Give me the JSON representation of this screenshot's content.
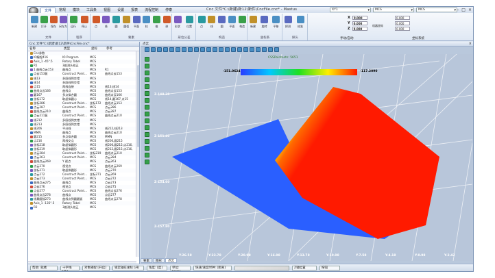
{
  "app": {
    "title": "Cnc 文件*C:\\新建\\新12\\新件\\CncFile.cnc* - Mastus"
  },
  "menu": {
    "tabs": [
      "文件",
      "常规",
      "模块",
      "工具条",
      "视图",
      "设置",
      "报表",
      "流程控制",
      "停泰"
    ],
    "active": 0
  },
  "selectors": {
    "coord1": "XY1",
    "coord2": "MCS",
    "coord3": "MCS"
  },
  "ribbon": {
    "groups": [
      {
        "label": "文件",
        "buttons": [
          "新建",
          "打开",
          "保存",
          "另存为"
        ]
      },
      {
        "label": "程序",
        "buttons": [
          "运行",
          "停止"
        ]
      },
      {
        "label": "要素",
        "buttons": [
          "点",
          "线",
          "圆",
          "圆弧",
          "平面",
          "柱",
          "椎",
          "球"
        ]
      },
      {
        "label": "形位公差",
        "buttons": [
          "形状",
          "位置"
        ]
      },
      {
        "label": "构造",
        "buttons": [
          "点",
          "线",
          "圆",
          "平面",
          "构造"
        ]
      },
      {
        "label": "坐标系",
        "buttons": [
          "新建",
          "旋转",
          "平移"
        ]
      },
      {
        "label": "探头",
        "buttons": [
          "探测",
          "校准"
        ]
      }
    ],
    "xyz": {
      "x": "0.000",
      "y": "0.000",
      "z": "0.000",
      "label": "机器坐标",
      "extra1": "0.000",
      "extra2": "0.000",
      "extra3": "0.000",
      "g1": "手动/自动",
      "g2": "坐标系统"
    }
  },
  "left_panel": {
    "title": "Cnc 文件*C:\\新建\\新12\\新件\\CncFile.cnc*",
    "columns": [
      "名称",
      "类型",
      "坐标",
      "参考"
    ],
    "rows": [
      [
        "Cnc参数",
        "",
        "",
        ""
      ],
      [
        "IO编程416",
        "IO Program",
        "MCS",
        ""
      ],
      [
        "Axis_1 -45°.5",
        "Rotary Tabel",
        "MCS",
        ""
      ],
      [
        "R1",
        "3维测头校正",
        "MCS",
        ""
      ],
      [
        "1 曲线点云153",
        "曲线点",
        "MCS",
        "R1"
      ],
      [
        "点云153复",
        "Construct Point...",
        "MCS",
        "曲线点云153"
      ],
      [
        "线13",
        "多段线到交错",
        "MCS",
        ""
      ],
      [
        "线14",
        "多段线到交错",
        "MCS",
        ""
      ],
      [
        "点15",
        "两线连接",
        "MCS",
        "线13,线14"
      ],
      [
        "曲线点云166",
        "曲线点",
        "MCS",
        "曲线点云153"
      ],
      [
        "圆167",
        "多点拟合圆",
        "MCS",
        "曲线点云166"
      ],
      [
        "坐标172",
        "取虚拟圆心",
        "MCS",
        "线14,圆167,点15"
      ],
      [
        "坐标286",
        "Construct Point...",
        "坐标172",
        "曲线点云153"
      ],
      [
        "点云287",
        "Construct Point...",
        "MCS",
        "点云286"
      ],
      [
        "曲线点云210",
        "曲线点",
        "MCS",
        "点云287"
      ],
      [
        "点云211复",
        "Construct Point...",
        "MCS",
        "曲线点云210"
      ],
      [
        "线212",
        "多段线到交错",
        "MCS",
        ""
      ],
      [
        "线213",
        "多段线到交错",
        "MCS",
        ""
      ],
      [
        "线206",
        "平分线",
        "MCS",
        "线212,线213"
      ],
      [
        "MMN",
        "曲线点",
        "MCS",
        "曲线点云210"
      ],
      [
        "圆215",
        "多点拟合圆",
        "MCS",
        "MMN"
      ],
      [
        "点216",
        "两线交点",
        "MCS",
        "线206,圆215"
      ],
      [
        "坐标218",
        "取虚拟圆形",
        "MCS",
        "线206,圆215,点216,"
      ],
      [
        "坐标219",
        "取虚拟圆形",
        "MCS",
        "线212,圆215,点216,"
      ],
      [
        "点云284",
        "Construct Point...",
        "坐标219",
        "曲线点云210"
      ],
      [
        "点云263",
        "Construct Point...",
        "MCS",
        "点云284"
      ],
      [
        "曲线点云269",
        "Y 视点",
        "MCS",
        "点云263"
      ],
      [
        "点云270",
        "视觉点",
        "MCS",
        "曲线点云269"
      ],
      [
        "坐标271",
        "取虚拟圆形",
        "MCS",
        "点云270"
      ],
      [
        "点云272",
        "Construct Point...",
        "坐标271",
        "点云269"
      ],
      [
        "点云273",
        "Construct Point...",
        "MCS",
        "点云272"
      ],
      [
        "曲线点云275",
        "曲线点",
        "MCS",
        "点云273"
      ],
      [
        "点云276",
        "视觉点",
        "MCS",
        "点云275"
      ],
      [
        "点云277",
        "Construct Point...",
        "MCS",
        "曲线点云276"
      ],
      [
        "曲线点云278",
        "曲线点",
        "MCS",
        "点云277"
      ],
      [
        "线最圆弧273",
        "曲线点到圆圆弧",
        "MCS",
        "曲线点云278"
      ],
      [
        "Axis_1 -135°.5",
        "Rotary Tabel",
        "MCS",
        ""
      ],
      [
        "R2",
        "3维测头校正",
        "MCS",
        ""
      ]
    ]
  },
  "view": {
    "tab": "点云",
    "colorbar": {
      "title": "CSSPointsets: 5651",
      "min": "-151.0624",
      "max": "-117.2090"
    },
    "z_labels": [
      "Z-148.20",
      "Z-151.40",
      "Z-154.60",
      "Z-157.80"
    ],
    "y_labels": [
      "Y-26.58",
      "Y-23.78",
      "Y-20.98",
      "Y-16.98",
      "Y-13.78",
      "Y-10.98",
      "Y-7.58",
      "Y-4.18",
      "Y-0.98",
      "Y-2.42"
    ]
  },
  "bottom_tabs": [
    "要素",
    "图形",
    "点云"
  ],
  "status": {
    "fields": [
      "帮助:   就绪",
      "十字线 [开]",
      "对象捕捉 [开启]",
      "锁定轴在坐标 [开]",
      "角度: [度]",
      "单位: [mm]",
      "快速/速度时钟: [距离]",
      "",
      "Z轴位置",
      "按钮"
    ]
  },
  "colors": {
    "accent": "#0a3d8f",
    "bg": "#dde6f1"
  }
}
